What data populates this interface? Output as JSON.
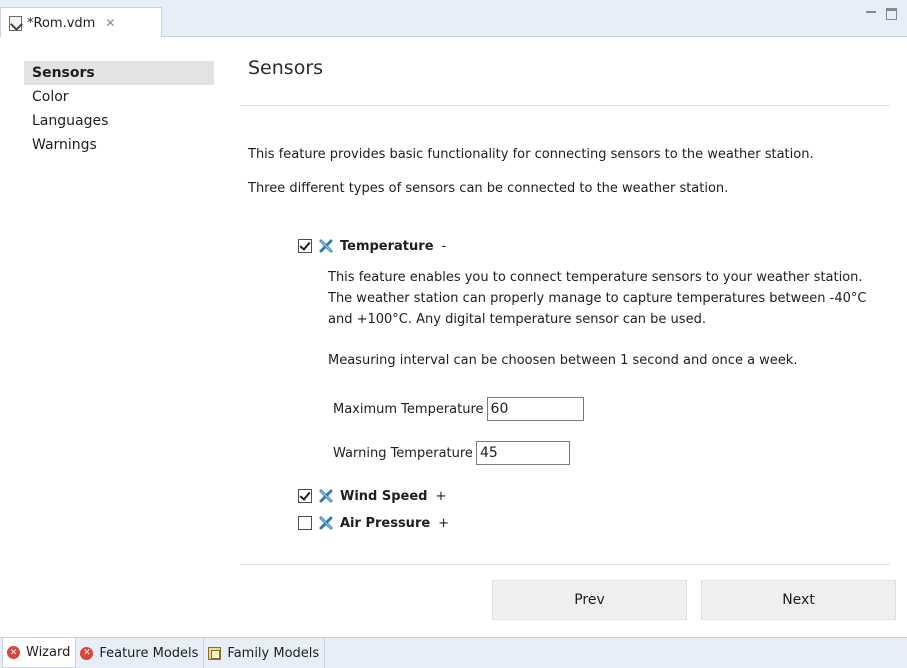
{
  "editor_tab": {
    "label": "*Rom.vdm",
    "close_glyph": "✕"
  },
  "sidebar": {
    "items": [
      {
        "label": "Sensors",
        "active": true
      },
      {
        "label": "Color",
        "active": false
      },
      {
        "label": "Languages",
        "active": false
      },
      {
        "label": "Warnings",
        "active": false
      }
    ]
  },
  "main": {
    "title": "Sensors",
    "intro": [
      "This feature provides basic functionality for connecting sensors to the weather station.",
      "Three different types of sensors can be connected to the weather station."
    ],
    "features": [
      {
        "name": "Temperature",
        "checked": true,
        "expander": "-",
        "description": "This feature enables you to connect temperature sensors to your weather station. The weather station can properly manage to capture temperatures between -40°C and +100°C. Any digital temperature sensor can be used.",
        "note": "Measuring interval can be choosen between 1 second and once a week.",
        "fields": [
          {
            "label": "Maximum Temperature",
            "value": "60"
          },
          {
            "label": "Warning Temperature",
            "value": "45"
          }
        ]
      },
      {
        "name": "Wind Speed",
        "checked": true,
        "expander": "+"
      },
      {
        "name": "Air Pressure",
        "checked": false,
        "expander": "+"
      }
    ],
    "buttons": {
      "prev": "Prev",
      "next": "Next"
    }
  },
  "bottom_tabs": [
    {
      "label": "Wizard",
      "icon": "error-icon",
      "active": true
    },
    {
      "label": "Feature Models",
      "icon": "error-icon",
      "active": false
    },
    {
      "label": "Family Models",
      "icon": "family-model-icon",
      "active": false
    }
  ],
  "colors": {
    "tabbar": "#e8eef7",
    "selected_nav": "#e3e3e3",
    "button": "#efefef",
    "error": "#d9453b",
    "feature_icon": "#2a7ab8"
  }
}
